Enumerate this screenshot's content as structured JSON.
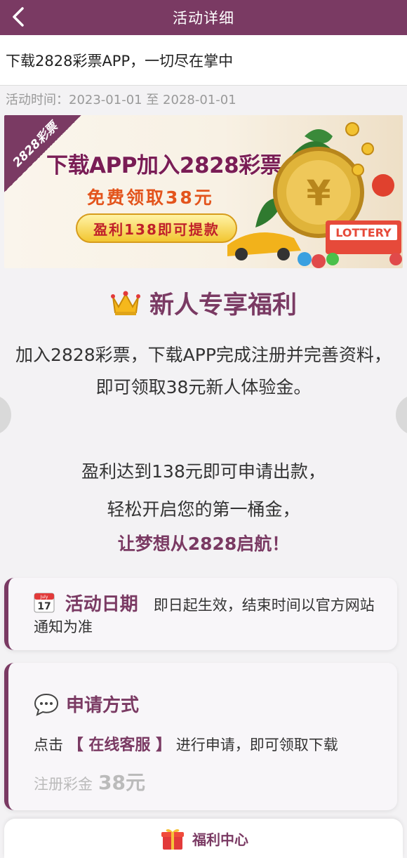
{
  "topbar": {
    "title": "活动详细"
  },
  "headline": "下载2828彩票APP，一切尽在掌中",
  "meta": {
    "time_label": "活动时间：",
    "time_value": "2023-01-01 至 2028-01-01"
  },
  "banner": {
    "corner_tag": "2828彩票",
    "title": "下载APP加入2828彩票",
    "subtitle": "免费领取38元",
    "pill": "盈利138即可提款",
    "lottery_label": "LOTTERY"
  },
  "welfare": {
    "title": "新人专享福利",
    "line1": "加入2828彩票，下载APP完成注册并完善资料，",
    "line2": "即可领取38元新人体验金。",
    "line3": "盈利达到138元即可申请出款，",
    "line4": "轻松开启您的第一桶金，",
    "highlight": "让梦想从2828启航！"
  },
  "date_card": {
    "calendar_month": "July",
    "calendar_day": "17",
    "label": "活动日期",
    "text": "即日起生效，结束时间以官方网站通知为准"
  },
  "apply_card": {
    "label": "申请方式",
    "line_prefix": "点击",
    "link_text": "【 在线客服 】",
    "line_suffix": "进行申请，即可领取下载",
    "fade_text": "注册彩金",
    "fade_amount": "38元"
  },
  "bottom_bar": {
    "label": "福利中心"
  },
  "colors": {
    "brand": "#7a3a63",
    "accent_red": "#c0202a"
  }
}
